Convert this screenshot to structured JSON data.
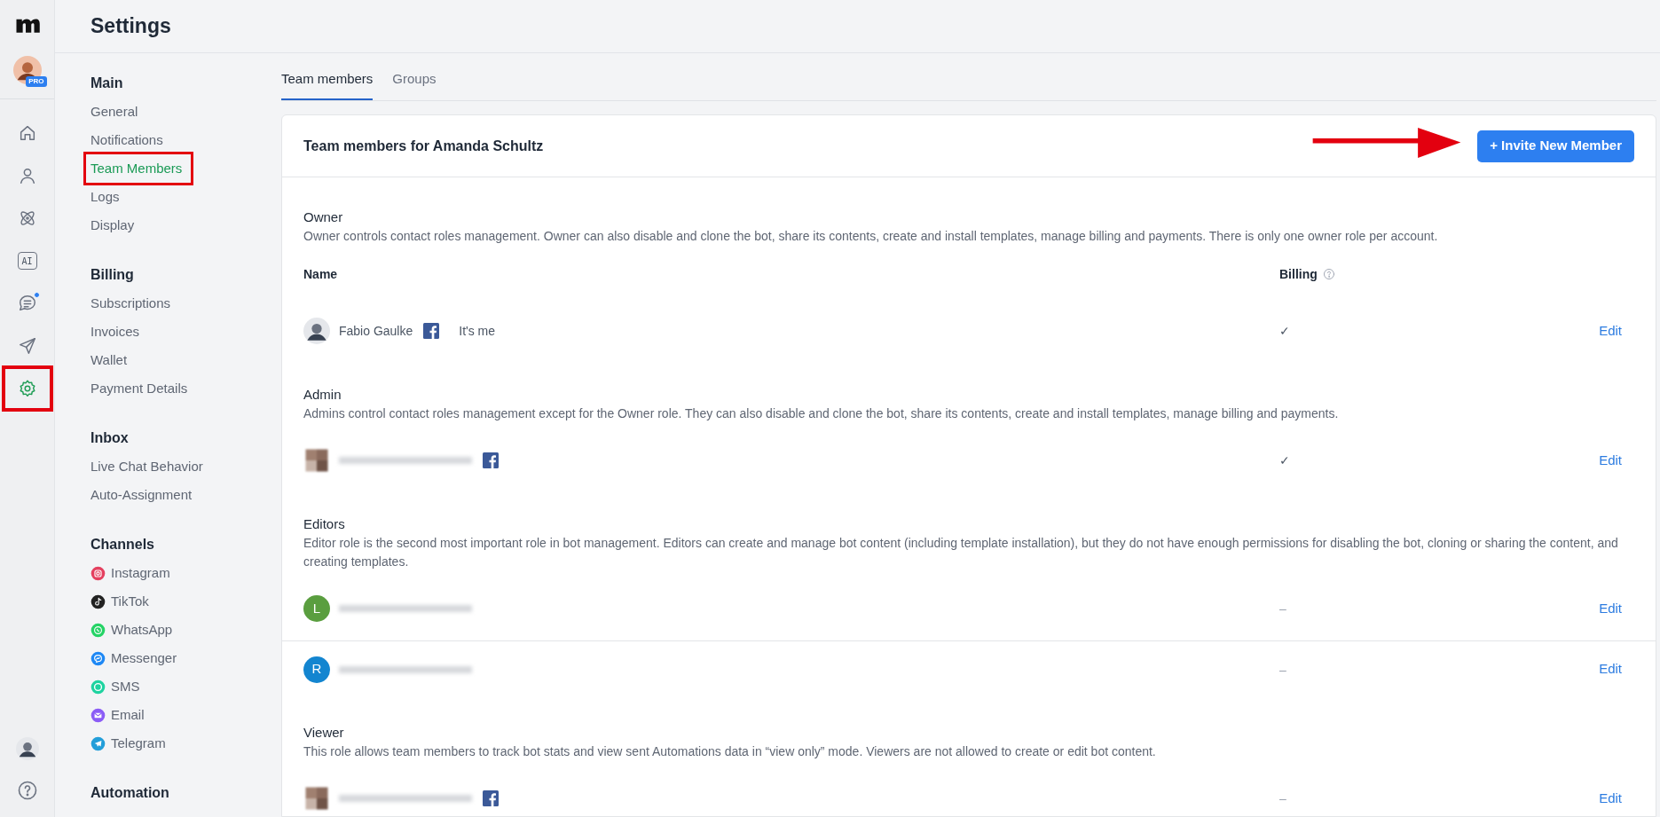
{
  "rail": {
    "avatar_badge": "PRO",
    "items": [
      {
        "kind": "home",
        "selected": false,
        "badge": false,
        "highlighted": false
      },
      {
        "kind": "person",
        "selected": false,
        "badge": false,
        "highlighted": false
      },
      {
        "kind": "atom",
        "selected": false,
        "badge": false,
        "highlighted": false
      },
      {
        "kind": "ai",
        "label": "AI",
        "selected": false,
        "badge": false,
        "highlighted": false
      },
      {
        "kind": "chat",
        "selected": false,
        "badge": true,
        "highlighted": false
      },
      {
        "kind": "send",
        "selected": false,
        "badge": false,
        "highlighted": false
      },
      {
        "kind": "gear",
        "selected": true,
        "badge": false,
        "highlighted": true
      }
    ]
  },
  "page_title": "Settings",
  "sidebar": {
    "sections": [
      {
        "title": "Main",
        "items": [
          {
            "label": "General",
            "selected": false,
            "highlighted": false
          },
          {
            "label": "Notifications",
            "selected": false,
            "highlighted": false
          },
          {
            "label": "Team Members",
            "selected": true,
            "highlighted": true
          },
          {
            "label": "Logs",
            "selected": false,
            "highlighted": false
          },
          {
            "label": "Display",
            "selected": false,
            "highlighted": false
          }
        ]
      },
      {
        "title": "Billing",
        "items": [
          {
            "label": "Subscriptions",
            "selected": false,
            "highlighted": false
          },
          {
            "label": "Invoices",
            "selected": false,
            "highlighted": false
          },
          {
            "label": "Wallet",
            "selected": false,
            "highlighted": false
          },
          {
            "label": "Payment Details",
            "selected": false,
            "highlighted": false
          }
        ]
      },
      {
        "title": "Inbox",
        "items": [
          {
            "label": "Live Chat Behavior",
            "selected": false,
            "highlighted": false
          },
          {
            "label": "Auto-Assignment",
            "selected": false,
            "highlighted": false
          }
        ]
      },
      {
        "title": "Channels",
        "items": [
          {
            "label": "Instagram",
            "kind": "instagram",
            "color": "#e4405f",
            "selected": false,
            "highlighted": false
          },
          {
            "label": "TikTok",
            "kind": "tiktok",
            "color": "#222222",
            "selected": false,
            "highlighted": false
          },
          {
            "label": "WhatsApp",
            "kind": "whatsapp",
            "color": "#25d366",
            "selected": false,
            "highlighted": false
          },
          {
            "label": "Messenger",
            "kind": "messenger",
            "color": "#1e88f5",
            "selected": false,
            "highlighted": false
          },
          {
            "label": "SMS",
            "kind": "sms",
            "color": "#1fd3a0",
            "selected": false,
            "highlighted": false
          },
          {
            "label": "Email",
            "kind": "email",
            "color": "#8b5cf6",
            "selected": false,
            "highlighted": false
          },
          {
            "label": "Telegram",
            "kind": "telegram",
            "color": "#229ed9",
            "selected": false,
            "highlighted": false
          }
        ]
      },
      {
        "title": "Automation"
      }
    ]
  },
  "tabs": [
    {
      "label": "Team members",
      "selected": true
    },
    {
      "label": "Groups",
      "selected": false
    }
  ],
  "card": {
    "title": "Team members for Amanda Schultz",
    "invite_button": "+ Invite New Member",
    "pointer_arrow": true,
    "columns": [
      "Name",
      "Billing"
    ],
    "roles": [
      {
        "title": "Owner",
        "description": "Owner controls contact roles management. Owner can also disable and clone the bot, share its contents, create and install templates, manage billing and payments. There is only one owner role per account.",
        "show_columns": true,
        "members": [
          {
            "kind": "photo",
            "name": "Fabio Gaulke",
            "redacted": false,
            "facebook": true,
            "note": "It's me",
            "billing": "✓",
            "action": "Edit",
            "divider_above": false
          }
        ]
      },
      {
        "title": "Admin",
        "description": "Admins control contact roles management except for the Owner role. They can also disable and clone the bot, share its contents, create and install templates, manage billing and payments.",
        "show_columns": false,
        "members": [
          {
            "kind": "blurred",
            "redacted": true,
            "facebook": true,
            "billing": "✓",
            "action": "Edit",
            "divider_above": false
          }
        ]
      },
      {
        "title": "Editors",
        "description": "Editor role is the second most important role in bot management. Editors can create and manage bot content (including template installation), but they do not have enough permissions for disabling the bot, cloning or sharing the content, and creating templates.",
        "show_columns": false,
        "members": [
          {
            "kind": "letter",
            "letter": "L",
            "color": "#5a9e3f",
            "redacted": true,
            "facebook": false,
            "billing": "–",
            "action": "Edit",
            "divider_above": false
          },
          {
            "kind": "letter",
            "letter": "R",
            "color": "#1385d0",
            "redacted": true,
            "facebook": false,
            "billing": "–",
            "action": "Edit",
            "divider_above": true
          }
        ]
      },
      {
        "title": "Viewer",
        "description": "This role allows team members to track bot stats and view sent Automations data in “view only” mode. Viewers are not allowed to create or edit bot content.",
        "show_columns": false,
        "members": [
          {
            "kind": "blurred",
            "redacted": true,
            "facebook": true,
            "billing": "–",
            "action": "Edit",
            "divider_above": false
          }
        ]
      }
    ]
  }
}
